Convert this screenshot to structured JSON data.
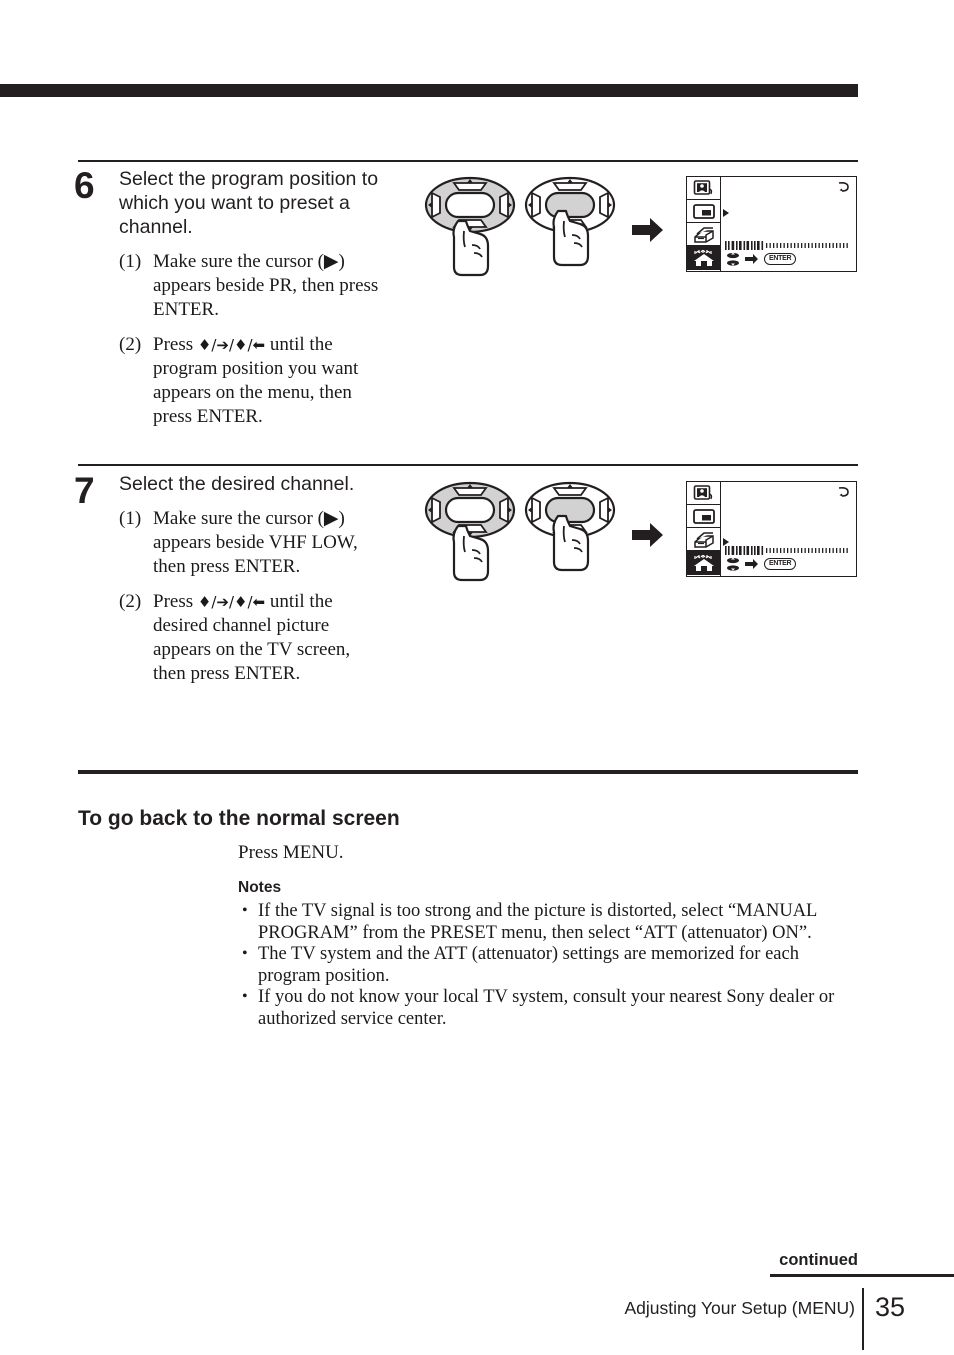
{
  "page": {
    "number": "35",
    "footer_title": "Adjusting Your Setup (MENU)",
    "continued_label": "continued"
  },
  "steps": [
    {
      "number": "6",
      "title": "Select the program position to which you want to preset a channel.",
      "substeps": [
        {
          "marker": "(1)",
          "text": "Make sure the cursor (▶) appears beside PR, then press ENTER."
        },
        {
          "marker": "(2)",
          "pre": "Press ",
          "arrows": "♦/➔/♦/⬅",
          "post": " until the program position you want appears on the menu, then press ENTER."
        }
      ],
      "tv": {
        "cursor_row": 2,
        "enter_label": "ENTER",
        "icons": [
          "picture-icon",
          "pip-screen-icon",
          "setup-stack-icon",
          "preset-house-icon"
        ]
      }
    },
    {
      "number": "7",
      "title": "Select the desired channel.",
      "substeps": [
        {
          "marker": "(1)",
          "text": "Make sure the cursor (▶) appears beside VHF LOW, then press ENTER."
        },
        {
          "marker": "(2)",
          "pre": "Press ",
          "arrows": "♦/➔/♦/⬅",
          "post": " until the desired channel picture appears on the TV screen, then press ENTER."
        }
      ],
      "tv": {
        "cursor_row": 3,
        "enter_label": "ENTER",
        "icons": [
          "picture-icon",
          "pip-screen-icon",
          "setup-stack-icon",
          "preset-house-icon"
        ]
      }
    }
  ],
  "normal_screen": {
    "heading": "To go back to the normal screen",
    "instruction": "Press MENU.",
    "notes_title": "Notes",
    "notes": [
      "If the TV signal is too strong and the picture is distorted, select “MANUAL PROGRAM”  from the PRESET menu, then select “ATT (attenuator) ON”.",
      "The TV system and the ATT (attenuator) settings are memorized for each program position.",
      "If you do not know your local TV system, consult your nearest Sony dealer or authorized service center."
    ]
  },
  "colors": {
    "ink": "#231f20",
    "jog_highlight": "#d2d2d2"
  }
}
